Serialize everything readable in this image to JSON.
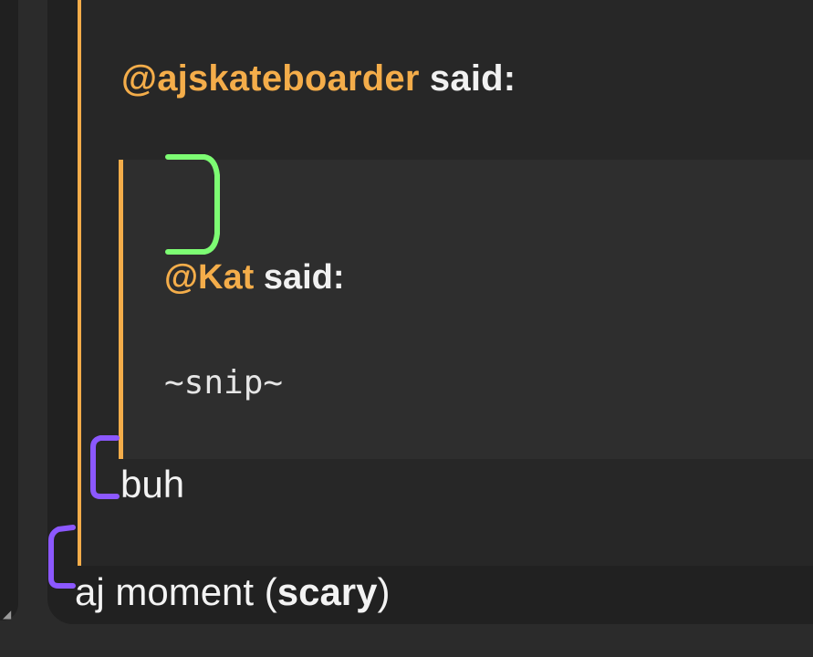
{
  "outer_quote": {
    "mention": "@ajskateboarder",
    "said": "said:"
  },
  "inner_quote": {
    "mention": "@Kat",
    "said": "said:",
    "snip": "~snip~"
  },
  "buh_text": "buh",
  "reply": {
    "before": "aj moment (",
    "bold": "scary",
    "after": ")"
  },
  "colors": {
    "quote_accent": "#f4ad4a",
    "green_annotation": "#7dfc73",
    "purple_annotation": "#8c58ff"
  }
}
